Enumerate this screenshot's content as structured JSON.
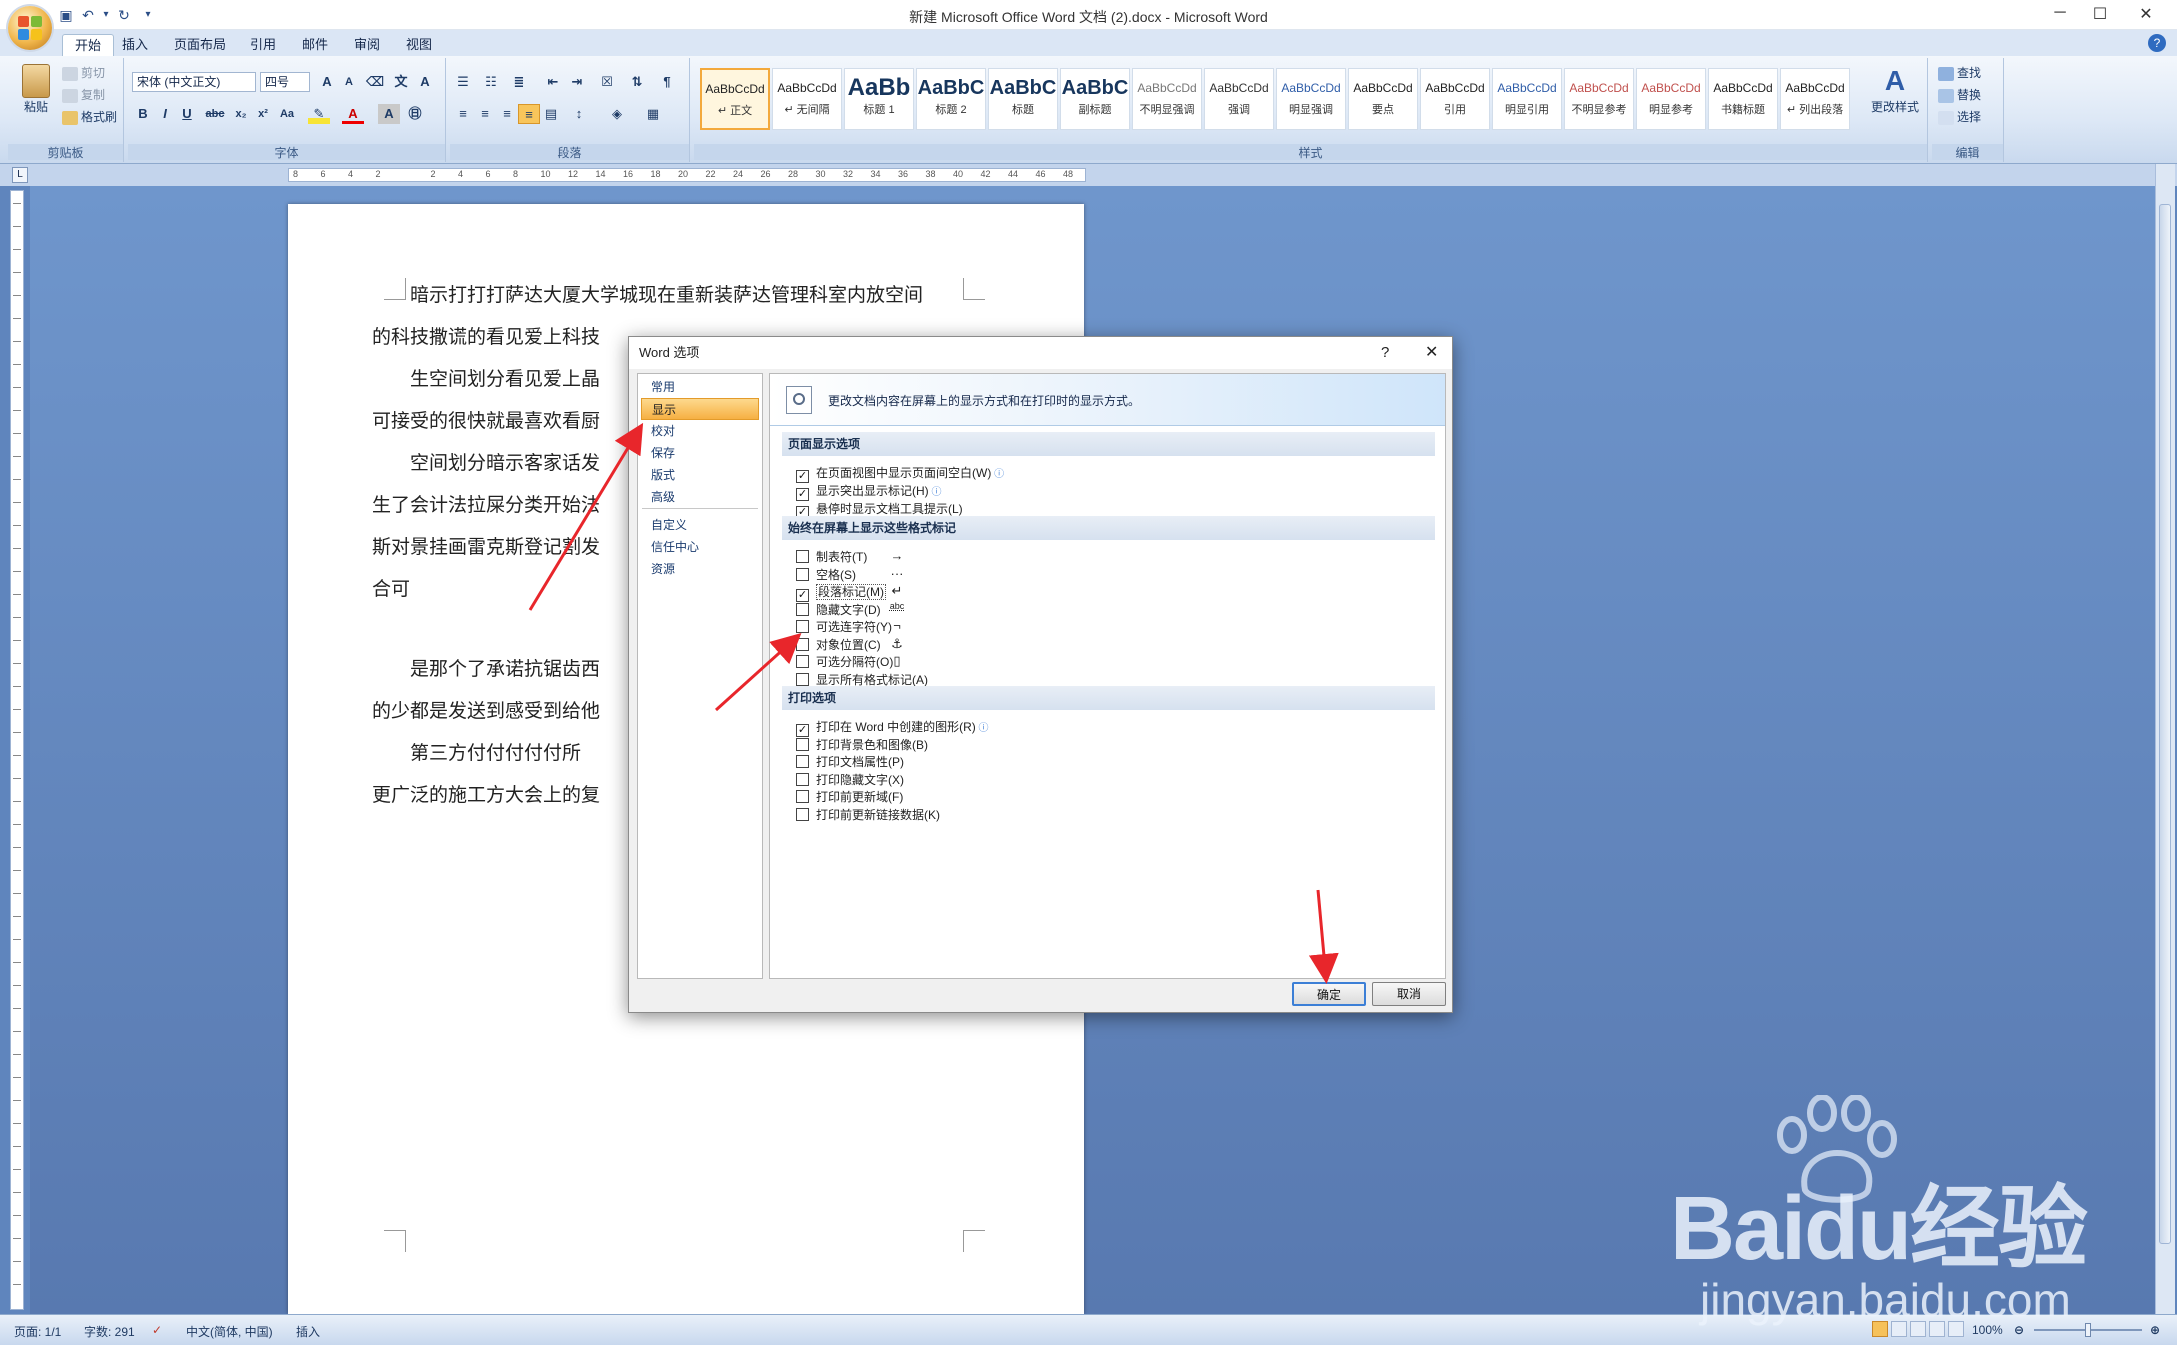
{
  "window": {
    "title": "新建 Microsoft Office Word 文档 (2).docx - Microsoft Word",
    "help": "?"
  },
  "tabs": [
    "开始",
    "插入",
    "页面布局",
    "引用",
    "邮件",
    "审阅",
    "视图"
  ],
  "ribbon": {
    "clipboard": {
      "paste": "粘贴",
      "cut": "剪切",
      "copy": "复制",
      "format_painter": "格式刷",
      "label": "剪贴板"
    },
    "font": {
      "font_name": "宋体 (中文正文)",
      "font_size": "四号",
      "label": "字体"
    },
    "paragraph": {
      "label": "段落"
    },
    "styles": {
      "label": "样式",
      "change_styles": "更改样式",
      "items": [
        {
          "preview": "AaBbCcDd",
          "name": "↵ 正文"
        },
        {
          "preview": "AaBbCcDd",
          "name": "↵ 无间隔"
        },
        {
          "preview": "AaBb",
          "name": "标题 1"
        },
        {
          "preview": "AaBbC",
          "name": "标题 2"
        },
        {
          "preview": "AaBbC",
          "name": "标题"
        },
        {
          "preview": "AaBbC",
          "name": "副标题"
        },
        {
          "preview": "AaBbCcDd",
          "name": "不明显强调"
        },
        {
          "preview": "AaBbCcDd",
          "name": "强调"
        },
        {
          "preview": "AaBbCcDd",
          "name": "明显强调"
        },
        {
          "preview": "AaBbCcDd",
          "name": "要点"
        },
        {
          "preview": "AaBbCcDd",
          "name": "引用"
        },
        {
          "preview": "AaBbCcDd",
          "name": "明显引用"
        },
        {
          "preview": "AaBbCcDd",
          "name": "不明显参考"
        },
        {
          "preview": "AaBbCcDd",
          "name": "明显参考"
        },
        {
          "preview": "AaBbCcDd",
          "name": "书籍标题"
        },
        {
          "preview": "AaBbCcDd",
          "name": "↵ 列出段落"
        }
      ]
    },
    "editing": {
      "find": "查找",
      "replace": "替换",
      "select": "选择",
      "label": "编辑"
    }
  },
  "document": {
    "lines": [
      "暗示打打打萨达大厦大学城现在重新装萨达管理科室内放空间",
      "的科技撒谎的看见爱上科技",
      "生空间划分看见爱上晶",
      "可接受的很快就最喜欢看厨",
      "空间划分暗示客家话发",
      "生了会计法拉屎分类开始法",
      "斯对景挂画雷克斯登记割发",
      "合可",
      "是那个了承诺抗锯齿西",
      "的少都是发送到感受到给他",
      "第三方付付付付付所",
      "更广泛的施工方大会上的复"
    ]
  },
  "dialog": {
    "title": "Word 选项",
    "help": "?",
    "nav": [
      "常用",
      "显示",
      "校对",
      "保存",
      "版式",
      "高级",
      "自定义",
      "信任中心",
      "资源"
    ],
    "selected_nav": "显示",
    "banner": "更改文档内容在屏幕上的显示方式和在打印时的显示方式。",
    "sections": {
      "page_display": {
        "title": "页面显示选项",
        "options": [
          {
            "label": "在页面视图中显示页面间空白(W)",
            "checked": true
          },
          {
            "label": "显示突出显示标记(H)",
            "checked": true
          },
          {
            "label": "悬停时显示文档工具提示(L)",
            "checked": true
          }
        ]
      },
      "format_marks": {
        "title": "始终在屏幕上显示这些格式标记",
        "options": [
          {
            "label": "制表符(T)",
            "checked": false,
            "mark": "→"
          },
          {
            "label": "空格(S)",
            "checked": false,
            "mark": "···"
          },
          {
            "label": "段落标记(M)",
            "checked": true,
            "mark": "↵"
          },
          {
            "label": "隐藏文字(D)",
            "checked": false,
            "mark": "abc"
          },
          {
            "label": "可选连字符(Y)",
            "checked": false,
            "mark": "¬"
          },
          {
            "label": "对象位置(C)",
            "checked": false,
            "mark": "⚓"
          },
          {
            "label": "可选分隔符(O)",
            "checked": false,
            "mark": "▯"
          },
          {
            "label": "显示所有格式标记(A)",
            "checked": false,
            "mark": ""
          }
        ]
      },
      "print": {
        "title": "打印选项",
        "options": [
          {
            "label": "打印在 Word 中创建的图形(R)",
            "checked": true
          },
          {
            "label": "打印背景色和图像(B)",
            "checked": false
          },
          {
            "label": "打印文档属性(P)",
            "checked": false
          },
          {
            "label": "打印隐藏文字(X)",
            "checked": false
          },
          {
            "label": "打印前更新域(F)",
            "checked": false
          },
          {
            "label": "打印前更新链接数据(K)",
            "checked": false
          }
        ]
      }
    },
    "ok": "确定",
    "cancel": "取消"
  },
  "status": {
    "page": "页面: 1/1",
    "words": "字数: 291",
    "language": "中文(简体, 中国)",
    "mode": "插入",
    "zoom": "100%"
  },
  "watermark": {
    "brand": "Baidu经验",
    "url": "jingyan.baidu.com"
  },
  "colors": {
    "accent": "#f3a93c",
    "arrow": "#e8262b",
    "ribbon": "#dde8f6",
    "doc_bg": "#5f85bd"
  }
}
